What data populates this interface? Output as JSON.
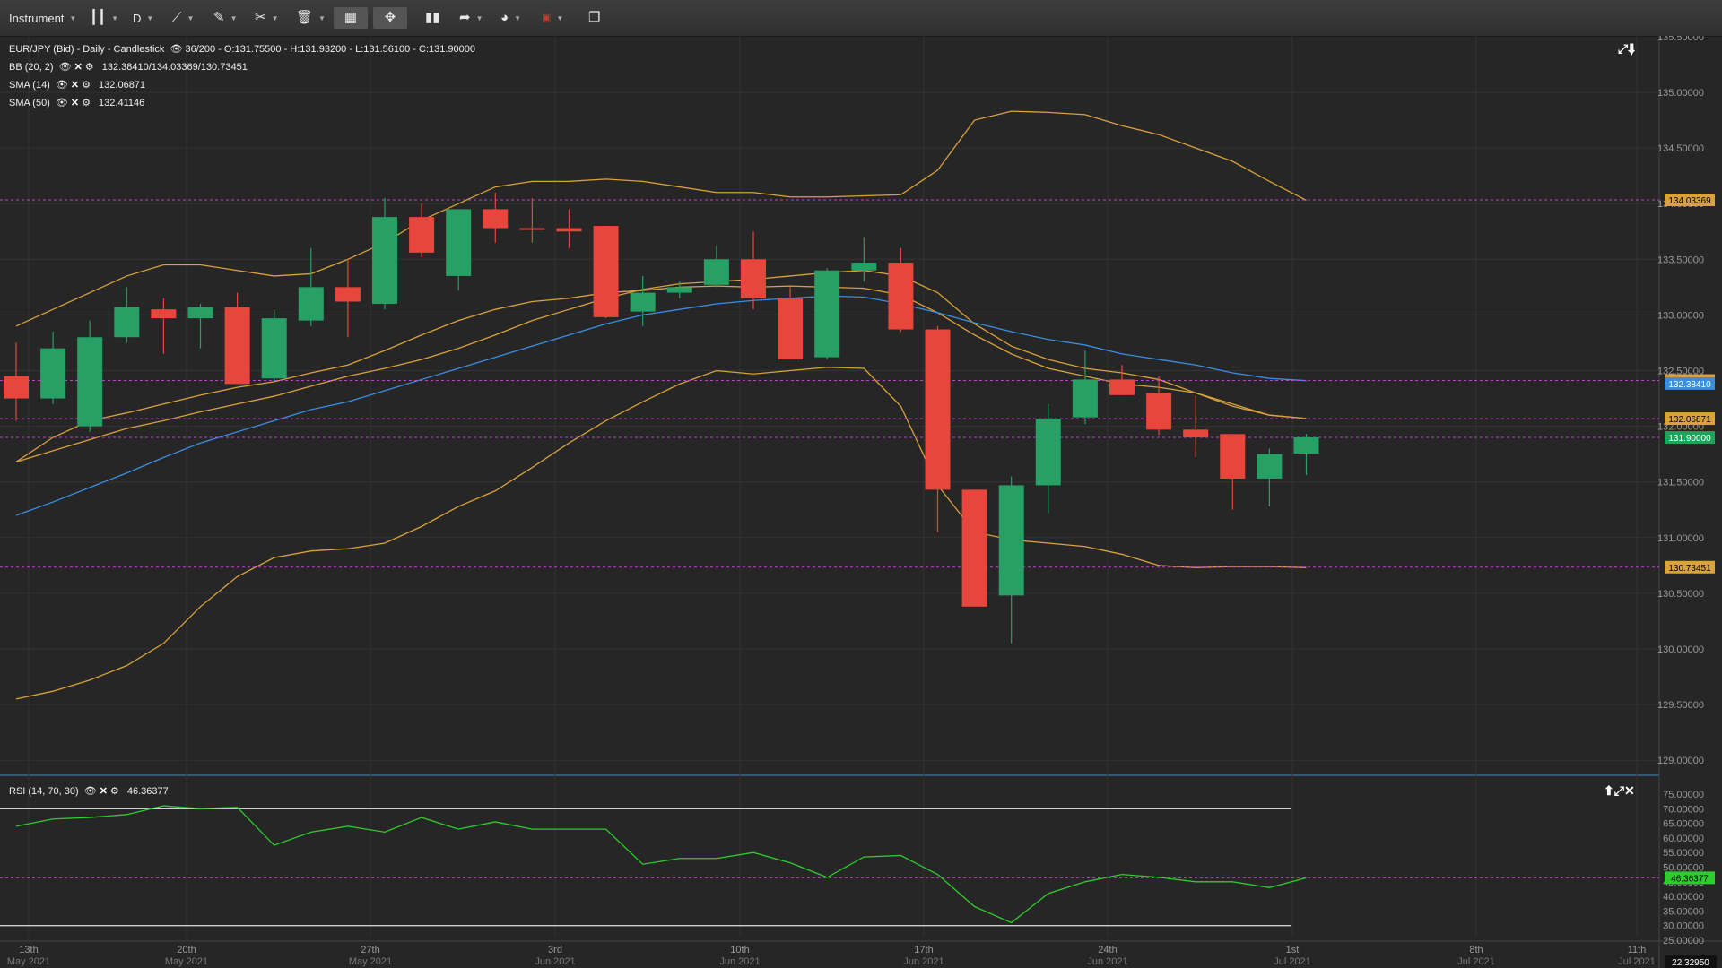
{
  "toolbar": {
    "instrument_label": "Instrument",
    "timeframe_label": "D",
    "icons": [
      "candlestick-icon",
      "line-tools-icon",
      "ruler-icon",
      "drawing-tools-icon",
      "delete-icon",
      "layout-icon",
      "fullscreen-icon",
      "bar-chart-icon",
      "share-icon",
      "palette-icon",
      "language-flag-icon",
      "window-icon"
    ]
  },
  "legend": {
    "title": "EUR/JPY (Bid) - Daily - Candlestick",
    "ohlc": "36/200 - O:131.75500 - H:131.93200 - L:131.56100 - C:131.90000",
    "bb_name": "BB (20, 2)",
    "bb_values": "132.38410/134.03369/130.73451",
    "sma14_name": "SMA (14)",
    "sma14_value": "132.06871",
    "sma50_name": "SMA (50)",
    "sma50_value": "132.41146",
    "rsi_name": "RSI (14, 70, 30)",
    "rsi_value": "46.36377"
  },
  "colors": {
    "bull": "#26a065",
    "bear": "#e8453c",
    "bb": "#d9a23a",
    "sma14": "#d9a23a",
    "sma50": "#3a8ee0",
    "rsi": "#2ecc2e",
    "hline": "#c040d0",
    "background": "#262626"
  },
  "price_axis": {
    "ticks": [
      "135.00000",
      "134.50000",
      "134.00000",
      "133.50000",
      "133.00000",
      "132.50000",
      "132.00000",
      "131.50000",
      "131.00000",
      "130.50000",
      "130.00000",
      "129.50000",
      "129.00000"
    ],
    "top_partial": "135.50000",
    "tags": [
      {
        "label": "134.03369",
        "value": 134.03369,
        "bg": "#d9a23a",
        "fg": "#000000"
      },
      {
        "label": "132.41146",
        "value": 132.41146,
        "bg": "#d9a23a",
        "fg": "#000000"
      },
      {
        "label": "132.38410",
        "value": 132.3841,
        "bg": "#3a8ee0",
        "fg": "#ffffff"
      },
      {
        "label": "132.06871",
        "value": 132.06871,
        "bg": "#d9a23a",
        "fg": "#000000"
      },
      {
        "label": "131.90000",
        "value": 131.9,
        "bg": "#1fa35a",
        "fg": "#ffffff"
      },
      {
        "label": "130.73451",
        "value": 130.73451,
        "bg": "#d9a23a",
        "fg": "#000000"
      }
    ]
  },
  "rsi_axis": {
    "ticks": [
      "75.00000",
      "70.00000",
      "65.00000",
      "60.00000",
      "55.00000",
      "50.00000",
      "45.00000",
      "40.00000",
      "35.00000",
      "30.00000",
      "25.00000"
    ],
    "tag": {
      "label": "46.36377",
      "value": 46.36377,
      "bg": "#2ecc2e",
      "fg": "#000000"
    }
  },
  "x_axis": {
    "labels": [
      {
        "day": "13th",
        "month": "May 2021"
      },
      {
        "day": "20th",
        "month": "May 2021"
      },
      {
        "day": "27th",
        "month": "May 2021"
      },
      {
        "day": "3rd",
        "month": "Jun 2021"
      },
      {
        "day": "10th",
        "month": "Jun 2021"
      },
      {
        "day": "17th",
        "month": "Jun 2021"
      },
      {
        "day": "24th",
        "month": "Jun 2021"
      },
      {
        "day": "1st",
        "month": "Jul 2021"
      },
      {
        "day": "8th",
        "month": "Jul 2021"
      },
      {
        "day": "11th",
        "month": "Jul 2021"
      }
    ],
    "corner_value": "22.32950"
  },
  "chart_data": {
    "type": "candlestick",
    "instrument": "EUR/JPY (Bid)",
    "timeframe": "Daily",
    "y_range": [
      128.9,
      135.55
    ],
    "candles": [
      {
        "o": 132.45,
        "h": 132.75,
        "l": 132.05,
        "c": 132.25
      },
      {
        "o": 132.25,
        "h": 132.85,
        "l": 132.2,
        "c": 132.7
      },
      {
        "o": 132.0,
        "h": 132.95,
        "l": 131.95,
        "c": 132.8
      },
      {
        "o": 132.8,
        "h": 133.25,
        "l": 132.75,
        "c": 133.07
      },
      {
        "o": 133.05,
        "h": 133.15,
        "l": 132.65,
        "c": 132.97
      },
      {
        "o": 132.97,
        "h": 133.1,
        "l": 132.7,
        "c": 133.07
      },
      {
        "o": 133.07,
        "h": 133.2,
        "l": 132.38,
        "c": 132.38
      },
      {
        "o": 132.43,
        "h": 133.05,
        "l": 132.4,
        "c": 132.97
      },
      {
        "o": 132.95,
        "h": 133.6,
        "l": 132.9,
        "c": 133.25
      },
      {
        "o": 133.25,
        "h": 133.5,
        "l": 132.8,
        "c": 133.12
      },
      {
        "o": 133.1,
        "h": 134.05,
        "l": 133.05,
        "c": 133.88
      },
      {
        "o": 133.88,
        "h": 134.0,
        "l": 133.52,
        "c": 133.56
      },
      {
        "o": 133.35,
        "h": 133.95,
        "l": 133.22,
        "c": 133.95
      },
      {
        "o": 133.95,
        "h": 134.1,
        "l": 133.65,
        "c": 133.78
      },
      {
        "o": 133.78,
        "h": 134.05,
        "l": 133.65,
        "c": 133.77
      },
      {
        "o": 133.78,
        "h": 133.95,
        "l": 133.6,
        "c": 133.75
      },
      {
        "o": 133.8,
        "h": 133.8,
        "l": 132.97,
        "c": 132.98
      },
      {
        "o": 133.03,
        "h": 133.35,
        "l": 132.9,
        "c": 133.2
      },
      {
        "o": 133.2,
        "h": 133.3,
        "l": 133.15,
        "c": 133.25
      },
      {
        "o": 133.27,
        "h": 133.62,
        "l": 133.25,
        "c": 133.5
      },
      {
        "o": 133.5,
        "h": 133.75,
        "l": 133.05,
        "c": 133.15
      },
      {
        "o": 133.15,
        "h": 133.25,
        "l": 132.6,
        "c": 132.6
      },
      {
        "o": 132.62,
        "h": 133.42,
        "l": 132.6,
        "c": 133.4
      },
      {
        "o": 133.4,
        "h": 133.7,
        "l": 133.3,
        "c": 133.47
      },
      {
        "o": 133.47,
        "h": 133.6,
        "l": 132.85,
        "c": 132.87
      },
      {
        "o": 132.87,
        "h": 132.9,
        "l": 131.05,
        "c": 131.43
      },
      {
        "o": 131.43,
        "h": 131.43,
        "l": 130.38,
        "c": 130.38
      },
      {
        "o": 130.48,
        "h": 131.55,
        "l": 130.05,
        "c": 131.47
      },
      {
        "o": 131.47,
        "h": 132.2,
        "l": 131.22,
        "c": 132.07
      },
      {
        "o": 132.08,
        "h": 132.68,
        "l": 132.02,
        "c": 132.42
      },
      {
        "o": 132.42,
        "h": 132.55,
        "l": 132.28,
        "c": 132.28
      },
      {
        "o": 132.3,
        "h": 132.45,
        "l": 131.92,
        "c": 131.97
      },
      {
        "o": 131.97,
        "h": 132.28,
        "l": 131.72,
        "c": 131.9
      },
      {
        "o": 131.93,
        "h": 131.93,
        "l": 131.25,
        "c": 131.53
      },
      {
        "o": 131.53,
        "h": 131.8,
        "l": 131.28,
        "c": 131.75
      },
      {
        "o": 131.755,
        "h": 131.932,
        "l": 131.561,
        "c": 131.9
      }
    ],
    "bb_upper": [
      132.9,
      133.05,
      133.2,
      133.35,
      133.45,
      133.45,
      133.4,
      133.35,
      133.37,
      133.5,
      133.65,
      133.85,
      134.0,
      134.15,
      134.2,
      134.2,
      134.22,
      134.2,
      134.15,
      134.1,
      134.1,
      134.06,
      134.06,
      134.07,
      134.08,
      134.3,
      134.75,
      134.83,
      134.82,
      134.8,
      134.7,
      134.62,
      134.5,
      134.38,
      134.2,
      134.03
    ],
    "bb_mid": [
      131.68,
      131.78,
      131.88,
      131.98,
      132.05,
      132.13,
      132.2,
      132.27,
      132.36,
      132.45,
      132.52,
      132.6,
      132.7,
      132.82,
      132.95,
      133.05,
      133.15,
      133.23,
      133.28,
      133.3,
      133.32,
      133.35,
      133.38,
      133.4,
      133.35,
      133.2,
      132.92,
      132.72,
      132.6,
      132.52,
      132.48,
      132.42,
      132.3,
      132.2,
      132.1,
      132.07
    ],
    "bb_lower": [
      129.55,
      129.62,
      129.72,
      129.85,
      130.05,
      130.38,
      130.65,
      130.82,
      130.88,
      130.9,
      130.95,
      131.1,
      131.28,
      131.42,
      131.63,
      131.85,
      132.05,
      132.22,
      132.38,
      132.5,
      132.47,
      132.5,
      132.53,
      132.52,
      132.18,
      131.47,
      131.05,
      130.98,
      130.95,
      130.92,
      130.85,
      130.75,
      130.73,
      130.74,
      130.74,
      130.73
    ],
    "sma14": [
      131.68,
      131.9,
      132.05,
      132.12,
      132.2,
      132.28,
      132.35,
      132.4,
      132.48,
      132.55,
      132.68,
      132.82,
      132.95,
      133.05,
      133.12,
      133.15,
      133.2,
      133.22,
      133.25,
      133.26,
      133.25,
      133.26,
      133.25,
      133.24,
      133.18,
      133.02,
      132.82,
      132.65,
      132.52,
      132.45,
      132.38,
      132.35,
      132.3,
      132.18,
      132.1,
      132.07
    ],
    "sma50": [
      131.2,
      131.32,
      131.45,
      131.58,
      131.72,
      131.85,
      131.95,
      132.05,
      132.15,
      132.22,
      132.32,
      132.42,
      132.52,
      132.62,
      132.72,
      132.82,
      132.92,
      133.0,
      133.05,
      133.1,
      133.13,
      133.15,
      133.17,
      133.16,
      133.1,
      133.02,
      132.93,
      132.85,
      132.78,
      132.73,
      132.65,
      132.6,
      132.55,
      132.48,
      132.43,
      132.41
    ],
    "rsi": [
      64,
      66.5,
      67,
      68,
      71,
      70,
      70.5,
      57.5,
      62,
      64,
      62,
      67,
      63,
      65.5,
      63,
      63,
      63,
      51,
      53,
      53,
      55,
      51.5,
      46.5,
      53.5,
      54,
      47.5,
      36.5,
      31,
      41,
      45,
      47.5,
      46.5,
      45,
      45,
      43,
      46.36
    ],
    "rsi_levels": [
      70,
      30
    ],
    "rsi_range": [
      25,
      75
    ]
  }
}
